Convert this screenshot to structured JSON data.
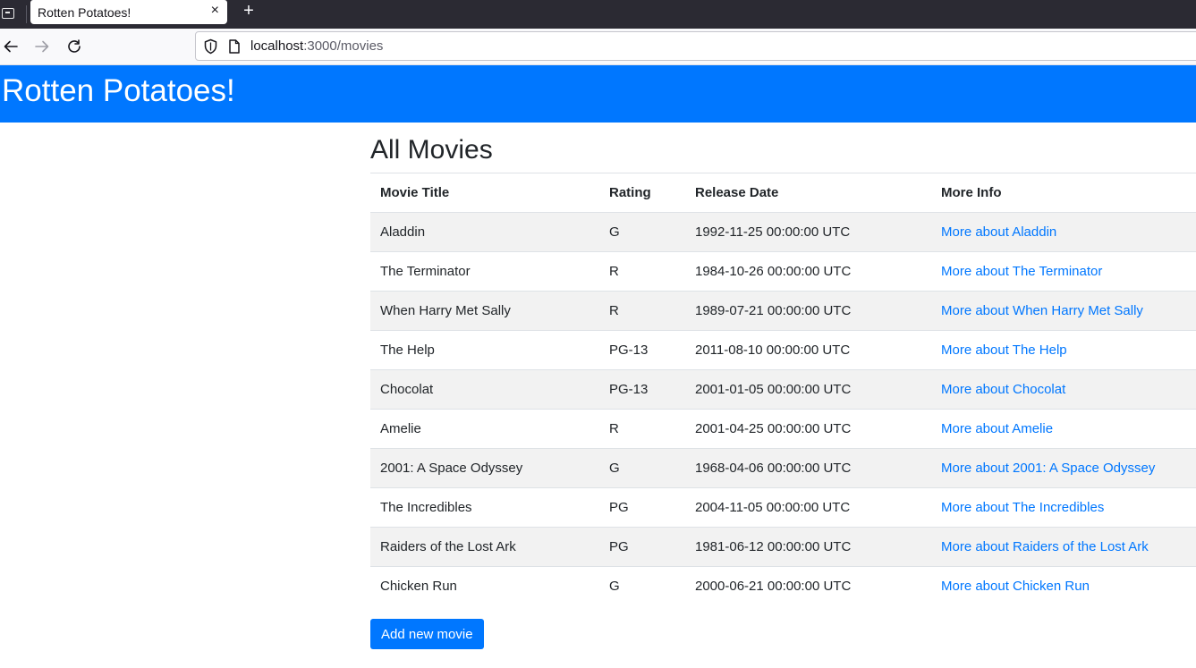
{
  "browser": {
    "tab_title": "Rotten Potatoes!",
    "tab_close": "×",
    "new_tab": "+",
    "url_host": "localhost",
    "url_rest": ":3000/movies"
  },
  "header": {
    "title": "Rotten Potatoes!"
  },
  "main": {
    "heading": "All Movies",
    "columns": [
      "Movie Title",
      "Rating",
      "Release Date",
      "More Info"
    ],
    "movies": [
      {
        "title": "Aladdin",
        "rating": "G",
        "release": "1992-11-25 00:00:00 UTC",
        "more": "More about Aladdin"
      },
      {
        "title": "The Terminator",
        "rating": "R",
        "release": "1984-10-26 00:00:00 UTC",
        "more": "More about The Terminator"
      },
      {
        "title": "When Harry Met Sally",
        "rating": "R",
        "release": "1989-07-21 00:00:00 UTC",
        "more": "More about When Harry Met Sally"
      },
      {
        "title": "The Help",
        "rating": "PG-13",
        "release": "2011-08-10 00:00:00 UTC",
        "more": "More about The Help"
      },
      {
        "title": "Chocolat",
        "rating": "PG-13",
        "release": "2001-01-05 00:00:00 UTC",
        "more": "More about Chocolat"
      },
      {
        "title": "Amelie",
        "rating": "R",
        "release": "2001-04-25 00:00:00 UTC",
        "more": "More about Amelie"
      },
      {
        "title": "2001: A Space Odyssey",
        "rating": "G",
        "release": "1968-04-06 00:00:00 UTC",
        "more": "More about 2001: A Space Odyssey"
      },
      {
        "title": "The Incredibles",
        "rating": "PG",
        "release": "2004-11-05 00:00:00 UTC",
        "more": "More about The Incredibles"
      },
      {
        "title": "Raiders of the Lost Ark",
        "rating": "PG",
        "release": "1981-06-12 00:00:00 UTC",
        "more": "More about Raiders of the Lost Ark"
      },
      {
        "title": "Chicken Run",
        "rating": "G",
        "release": "2000-06-21 00:00:00 UTC",
        "more": "More about Chicken Run"
      }
    ],
    "add_button": "Add new movie"
  },
  "colors": {
    "primary": "#0077ff",
    "stripe": "#f2f2f2",
    "text": "#212529"
  },
  "icons": [
    "tab-list-icon",
    "close-icon",
    "plus-icon",
    "back-arrow-icon",
    "forward-arrow-icon",
    "reload-icon",
    "shield-icon",
    "page-icon"
  ]
}
